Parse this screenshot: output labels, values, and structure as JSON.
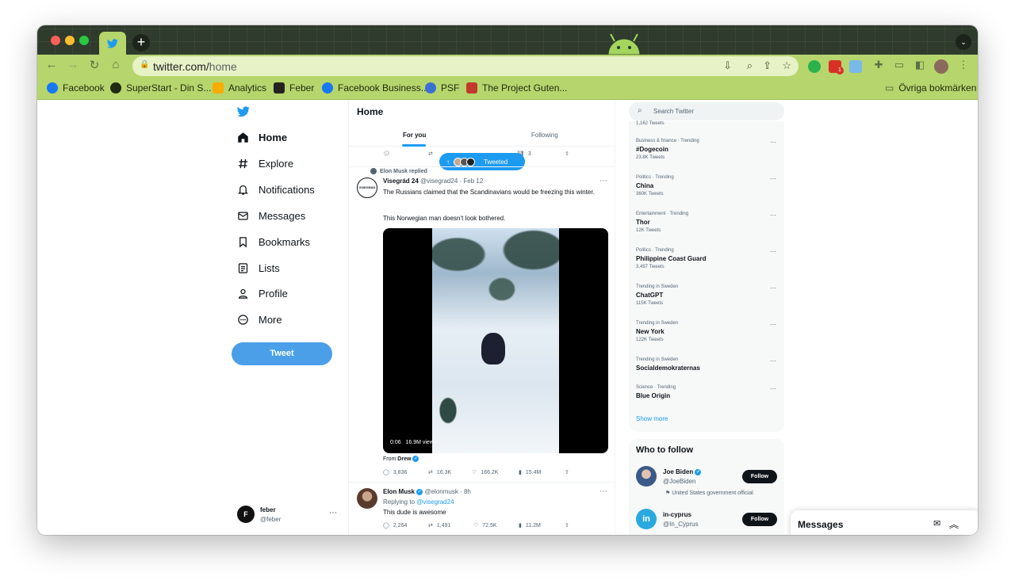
{
  "browser": {
    "url_host": "twitter.com/",
    "url_path": "home",
    "bookmarks": [
      {
        "label": "Facebook",
        "color": "#1877f2"
      },
      {
        "label": "SuperStart - Din S...",
        "color": "#1f2a12"
      },
      {
        "label": "Analytics",
        "color": "#f9ab00"
      },
      {
        "label": "Feber",
        "color": "#222222"
      },
      {
        "label": "Facebook Business...",
        "color": "#1877f2"
      },
      {
        "label": "PSF",
        "color": "#3b6fd3"
      },
      {
        "label": "The Project Guten...",
        "color": "#c0392b"
      }
    ],
    "other_bookmarks": "Övriga bokmärken",
    "ext_badge": "1"
  },
  "nav": {
    "items": [
      {
        "label": "Home",
        "icon": "home-icon"
      },
      {
        "label": "Explore",
        "icon": "hashtag-icon"
      },
      {
        "label": "Notifications",
        "icon": "bell-icon"
      },
      {
        "label": "Messages",
        "icon": "envelope-icon"
      },
      {
        "label": "Bookmarks",
        "icon": "bookmark-icon"
      },
      {
        "label": "Lists",
        "icon": "list-icon"
      },
      {
        "label": "Profile",
        "icon": "person-icon"
      },
      {
        "label": "More",
        "icon": "more-circle-icon"
      }
    ],
    "tweet_button": "Tweet",
    "account": {
      "name": "feber",
      "handle": "@feber"
    }
  },
  "timeline": {
    "title": "Home",
    "tabs": [
      "For you",
      "Following"
    ],
    "top_stats": {
      "views": "3"
    },
    "tweeted_pill": "Tweeted",
    "tweet1": {
      "context": "Elon Musk replied",
      "author": "Visegrád 24",
      "handle": "@visegrad24",
      "time": "· Feb 12",
      "text1": "The Russians claimed that the Scandinavians would be freezing this winter.",
      "text2": "This Norwegian man doesn’t look bothered.",
      "video_time": "0:06",
      "video_views": "16.9M views",
      "from_label": "From",
      "from_name": "Drew",
      "stats": {
        "replies": "3,836",
        "retweets": "16.3K",
        "likes": "166.2K",
        "views": "15.4M"
      }
    },
    "tweet2": {
      "author": "Elon Musk",
      "handle": "@elonmusk",
      "time": "· 8h",
      "reply_prefix": "Replying to",
      "reply_to": "@visegrad24",
      "text": "This dude is awesome",
      "stats": {
        "replies": "2,264",
        "retweets": "1,491",
        "likes": "72.5K",
        "views": "11.2M"
      }
    }
  },
  "search": {
    "placeholder": "Search Twitter"
  },
  "trends": {
    "top_count": "1,162 Tweets",
    "items": [
      {
        "category": "Business & finance · Trending",
        "name": "#Dogecoin",
        "count": "23.8K Tweets"
      },
      {
        "category": "Politics · Trending",
        "name": "China",
        "count": "360K Tweets"
      },
      {
        "category": "Entertainment · Trending",
        "name": "Thor",
        "count": "12K Tweets"
      },
      {
        "category": "Politics · Trending",
        "name": "Philippine Coast Guard",
        "count": "3,497 Tweets"
      },
      {
        "category": "Trending in Sweden",
        "name": "ChatGPT",
        "count": "115K Tweets"
      },
      {
        "category": "Trending in Sweden",
        "name": "New York",
        "count": "122K Tweets"
      },
      {
        "category": "Trending in Sweden",
        "name": "Socialdemokraternas",
        "count": ""
      },
      {
        "category": "Science · Trending",
        "name": "Blue Origin",
        "count": ""
      }
    ],
    "show_more": "Show more"
  },
  "who_to_follow": {
    "title": "Who to follow",
    "accounts": [
      {
        "name": "Joe Biden",
        "handle": "@JoeBiden",
        "note": "United States government official",
        "button": "Follow"
      },
      {
        "name": "in-cyprus",
        "handle": "@In_Cyprus",
        "button": "Follow"
      }
    ]
  },
  "messages_drawer": {
    "title": "Messages"
  },
  "colors": {
    "twitter_blue": "#1d9bf0",
    "toolbar": "#b6d56c",
    "tweet_button": "#4a9fe8"
  }
}
